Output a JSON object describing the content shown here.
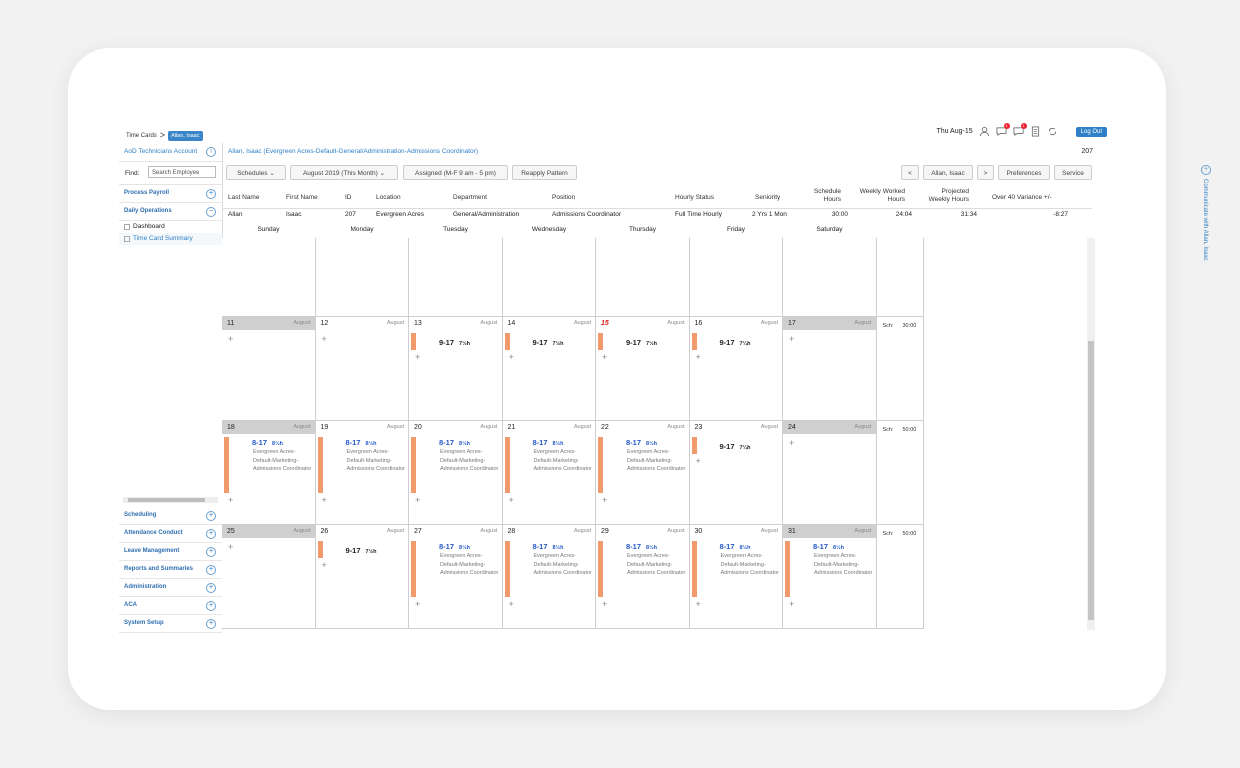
{
  "breadcrumb": {
    "root": "Time Cards",
    "current": "Allan, Isaac"
  },
  "header": {
    "date": "Thu Aug-15",
    "logout_label": "Log Out",
    "alerts_count_a": "1",
    "alerts_count_b": "1"
  },
  "sidebar": {
    "account": "AoD Technicians Account",
    "find_label": "Find:",
    "find_placeholder": "Search Employee",
    "sections_top": [
      {
        "label": "Process Payroll"
      },
      {
        "label": "Daily Operations"
      }
    ],
    "sub_items": [
      {
        "label": "Dashboard"
      },
      {
        "label": "Time Card Summary"
      }
    ],
    "sections_bottom": [
      {
        "label": "Scheduling"
      },
      {
        "label": "Attendance Conduct"
      },
      {
        "label": "Leave Management"
      },
      {
        "label": "Reports and Summaries"
      },
      {
        "label": "Administration"
      },
      {
        "label": "ACA"
      },
      {
        "label": "System Setup"
      }
    ]
  },
  "employee": {
    "title": "Allan, Isaac (Evergreen Acres-Default-General/Administration-Admissions Coordinator)",
    "id_display": "207"
  },
  "toolbar": {
    "schedules": "Schedules",
    "period": "August 2019 (This Month)",
    "assigned": "Assigned (M-F 9 am - 5 pm)",
    "reapply": "Reapply Pattern",
    "prev": "<",
    "employee": "Allan, Isaac",
    "next": ">",
    "preferences": "Preferences",
    "service": "Service"
  },
  "side_panel": {
    "label": "Communicate with Allan, Isaac"
  },
  "table": {
    "headers": [
      "Last Name",
      "First Name",
      "ID",
      "Location",
      "Department",
      "Position",
      "Hourly Status",
      "Seniority",
      "Schedule\nHours",
      "Weekly Worked\nHours",
      "Projected\nWeekly Hours",
      "Over 40 Variance +/-"
    ],
    "row": [
      "Allan",
      "Isaac",
      "207",
      "Evergreen Acres",
      "General/Administration",
      "Admissions Coordinator",
      "Full Time Hourly",
      "2 Yrs 1 Mon",
      "30:00",
      "24:04",
      "31:34",
      "-8:27"
    ]
  },
  "days": [
    "Sunday",
    "Monday",
    "Tuesday",
    "Wednesday",
    "Thursday",
    "Friday",
    "Saturday"
  ],
  "month_label": "August",
  "sch_label": "Sch:",
  "weeks": [
    {
      "sch": "",
      "cells": [
        {},
        {},
        {},
        {},
        {},
        {},
        {}
      ]
    },
    {
      "sch": "30:00",
      "cells": [
        {
          "day": "11",
          "weekend": true
        },
        {
          "day": "12"
        },
        {
          "day": "13",
          "shift": "9-17",
          "hrs": "7½h"
        },
        {
          "day": "14",
          "shift": "9-17",
          "hrs": "7½h"
        },
        {
          "day": "15",
          "today": true,
          "shift": "9-17",
          "hrs": "7½h"
        },
        {
          "day": "16",
          "shift": "9-17",
          "hrs": "7¼h"
        },
        {
          "day": "17",
          "weekend": true
        }
      ]
    },
    {
      "sch": "50:00",
      "cells": [
        {
          "day": "18",
          "weekend": true,
          "shift": "8-17",
          "hrs": "8½h",
          "blue": true,
          "desc": "Evergreen Acres-Default-Marketing-Admissions Coordinator"
        },
        {
          "day": "19",
          "shift": "8-17",
          "hrs": "8½h",
          "blue": true,
          "desc": "Evergreen Acres-Default-Marketing-Admissions Coordinator"
        },
        {
          "day": "20",
          "shift": "8-17",
          "hrs": "8½h",
          "blue": true,
          "desc": "Evergreen Acres-Default-Marketing-Admissions Coordinator"
        },
        {
          "day": "21",
          "shift": "8-17",
          "hrs": "8½h",
          "blue": true,
          "desc": "Evergreen Acres-Default-Marketing-Admissions Coordinator"
        },
        {
          "day": "22",
          "shift": "8-17",
          "hrs": "8½h",
          "blue": true,
          "desc": "Evergreen Acres-Default-Marketing-Admissions Coordinator"
        },
        {
          "day": "23",
          "shift": "9-17",
          "hrs": "7¼h"
        },
        {
          "day": "24",
          "weekend": true
        }
      ]
    },
    {
      "sch": "50:00",
      "cells": [
        {
          "day": "25",
          "weekend": true
        },
        {
          "day": "26",
          "shift": "9-17",
          "hrs": "7½h"
        },
        {
          "day": "27",
          "shift": "8-17",
          "hrs": "8½h",
          "blue": true,
          "desc": "Evergreen Acres-Default-Marketing-Admissions Coordinator"
        },
        {
          "day": "28",
          "shift": "8-17",
          "hrs": "8½h",
          "blue": true,
          "desc": "Evergreen Acres-Default-Marketing-Admissions Coordinator"
        },
        {
          "day": "29",
          "shift": "8-17",
          "hrs": "8½h",
          "blue": true,
          "desc": "Evergreen Acres-Default-Marketing-Admissions Coordinator"
        },
        {
          "day": "30",
          "shift": "8-17",
          "hrs": "8½h",
          "blue": true,
          "desc": "Evergreen Acres-Default-Marketing-Admissions Coordinator"
        },
        {
          "day": "31",
          "weekend": true,
          "shift": "8-17",
          "hrs": "8½h",
          "blue": true,
          "desc": "Evergreen Acres-Default-Marketing-Admissions Coordinator"
        }
      ]
    }
  ]
}
